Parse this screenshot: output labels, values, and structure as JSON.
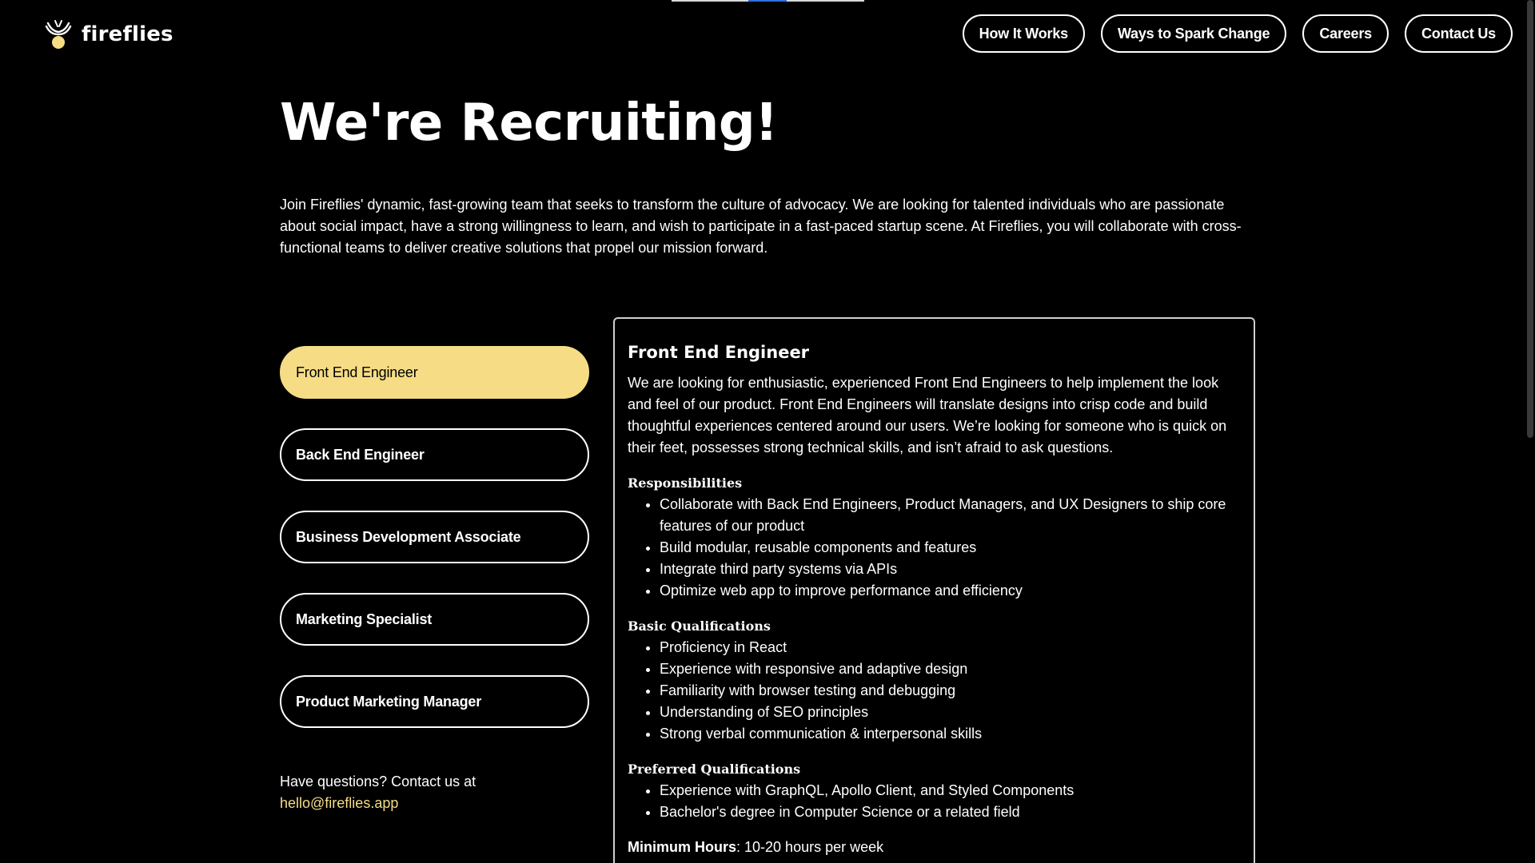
{
  "header": {
    "brand": "fireflies",
    "nav": [
      {
        "label": "How It Works"
      },
      {
        "label": "Ways to Spark Change"
      },
      {
        "label": "Careers"
      },
      {
        "label": "Contact Us"
      }
    ]
  },
  "hero": {
    "title": "We're Recruiting!",
    "intro": "Join Fireflies' dynamic, fast-growing team that seeks to transform the culture of advocacy. We are looking for talented individuals who are passionate about social impact, have a strong willingness to learn, and wish to participate in a fast-paced startup scene. At Fireflies, you will collaborate with cross-functional teams to deliver creative solutions that propel our mission forward."
  },
  "jobs": [
    {
      "label": "Front End Engineer",
      "selected": true
    },
    {
      "label": "Back End Engineer",
      "selected": false
    },
    {
      "label": "Business Development Associate",
      "selected": false
    },
    {
      "label": "Marketing Specialist",
      "selected": false
    },
    {
      "label": "Product Marketing Manager",
      "selected": false
    }
  ],
  "contact": {
    "text": "Have questions? Contact us at",
    "email": "hello@fireflies.app"
  },
  "detail": {
    "title": "Front End Engineer",
    "description": "We are looking for enthusiastic, experienced Front End Engineers to help implement the look and feel of our product. Front End Engineers will translate designs into crisp code and build thoughtful experiences centered around our users. We’re looking for someone who is quick on their feet, possesses strong technical skills, and isn’t afraid to ask questions.",
    "responsibilities_heading": "Responsibilities",
    "responsibilities": [
      "Collaborate with Back End Engineers, Product Managers, and UX Designers to ship core features of our product",
      "Build modular, reusable components and features",
      "Integrate third party systems via APIs",
      "Optimize web app to improve performance and efficiency"
    ],
    "basic_heading": "Basic Qualifications",
    "basic": [
      "Proficiency in React",
      "Experience with responsive and adaptive design",
      "Familiarity with browser testing and debugging",
      "Understanding of SEO principles",
      "Strong verbal communication & interpersonal skills"
    ],
    "preferred_heading": "Preferred Qualifications",
    "preferred": [
      "Experience with GraphQL, Apollo Client, and Styled Components",
      "Bachelor's degree in Computer Science or a related field"
    ],
    "min_hours_label": "Minimum Hours",
    "min_hours_value": ": 10-20 hours per week"
  },
  "colors": {
    "background": "#000000",
    "accent": "#f6dd85",
    "text": "#ffffff",
    "progress": "#2f6fde"
  }
}
